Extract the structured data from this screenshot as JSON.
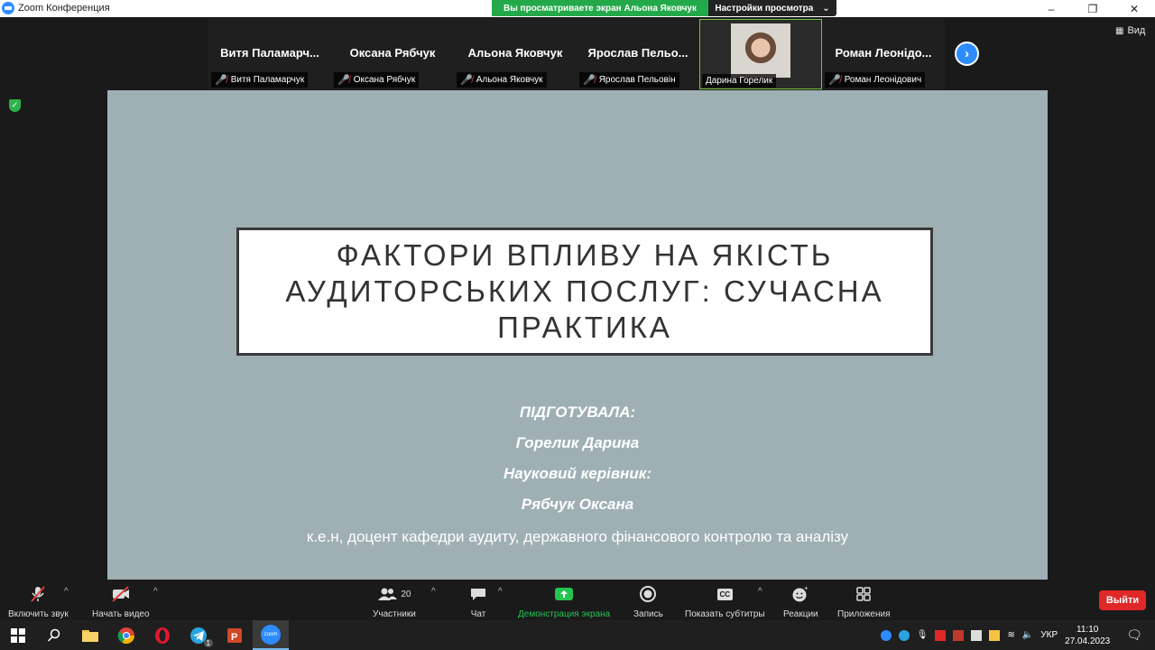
{
  "window": {
    "title": "Zoom Конференция",
    "buttons": [
      "–",
      "❐",
      "✕"
    ]
  },
  "share_banner": {
    "text": "Вы просматриваете экран Альона Яковчук",
    "options_label": "Настройки просмотра"
  },
  "view_button": {
    "label": "Вид"
  },
  "participants_strip": [
    {
      "big": "Витя  Паламарч...",
      "small": "Витя Паламарчук",
      "muted": true
    },
    {
      "big": "Оксана Рябчук",
      "small": "Оксана Рябчук",
      "muted": true
    },
    {
      "big": "Альона Яковчук",
      "small": "Альона Яковчук",
      "muted": true
    },
    {
      "big": "Ярослав  Пельо...",
      "small": "Ярослав Пельовін",
      "muted": true
    },
    {
      "big": "",
      "small": "Дарина Горелик",
      "muted": false,
      "video": true
    },
    {
      "big": "Роман  Леонідо...",
      "small": "Роман Леонідович",
      "muted": true
    }
  ],
  "slide": {
    "title_lines": [
      "ФАКТОРИ ВПЛИВУ НА ЯКІСТЬ",
      "АУДИТОРСЬКИХ ПОСЛУГ: СУЧАСНА",
      "ПРАКТИКА"
    ],
    "prepared_label": "ПІДГОТУВАЛА:",
    "author": "Горелик Дарина",
    "advisor_label": "Науковий керівник:",
    "advisor": "Рябчук Оксана",
    "advisor_info": "к.е.н,  доцент кафедри аудиту, державного фінансового контролю та аналізу"
  },
  "controls": {
    "unmute": "Включить звук",
    "start_video": "Начать видео",
    "participants": "Участники",
    "participants_count": "20",
    "chat": "Чат",
    "share": "Демонстрация экрана",
    "record": "Запись",
    "captions": "Показать субтитры",
    "captions_icon_text": "CC",
    "reactions": "Реакции",
    "apps": "Приложения",
    "leave": "Выйти"
  },
  "taskbar": {
    "language": "УКР",
    "time": "11:10",
    "date": "27.04.2023",
    "telegram_badge": "1",
    "zoom_label": "zoom"
  },
  "colors": {
    "share_green": "#23a94a",
    "slide_bg": "#9fb0b5",
    "leave_red": "#e02828",
    "zoom_blue": "#2d8cff"
  }
}
